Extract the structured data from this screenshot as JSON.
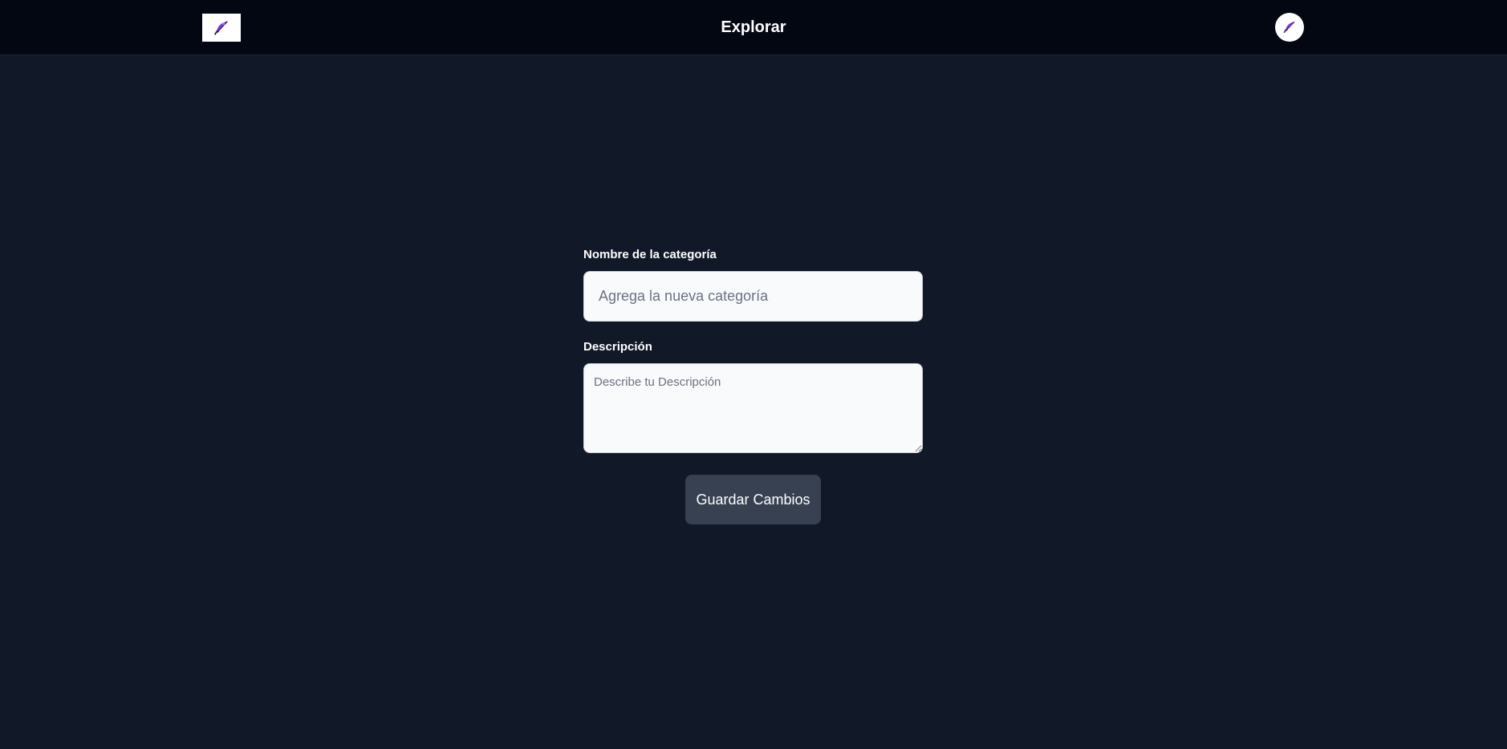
{
  "header": {
    "title": "Explorar",
    "logo_icon": "feather-quill-icon",
    "avatar_icon": "feather-quill-icon"
  },
  "form": {
    "name_label": "Nombre de la categoría",
    "name_placeholder": "Agrega la nueva categoría",
    "name_value": "",
    "description_label": "Descripción",
    "description_placeholder": "Describe tu Descripción",
    "description_value": "",
    "save_label": "Guardar Cambios"
  },
  "colors": {
    "page_background": "#111827",
    "header_background": "#030712",
    "input_background": "#f8fafc",
    "button_background": "#374151",
    "icon_purple": "#7c3aed"
  }
}
